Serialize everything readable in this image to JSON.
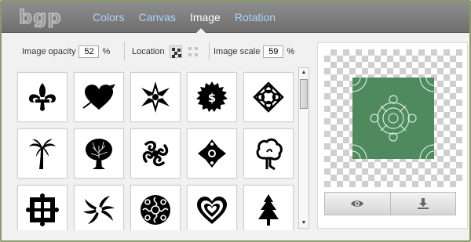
{
  "app": {
    "logo_text": "bgp"
  },
  "nav": {
    "tabs": [
      {
        "label": "Colors",
        "active": false
      },
      {
        "label": "Canvas",
        "active": false
      },
      {
        "label": "Image",
        "active": true
      },
      {
        "label": "Rotation",
        "active": false
      }
    ]
  },
  "controls": {
    "opacity_label": "Image opacity",
    "opacity_value": "52",
    "opacity_unit": "%",
    "location_label": "Location",
    "scale_label": "Image scale",
    "scale_value": "59",
    "scale_unit": "%"
  },
  "icons": [
    [
      "fleur-de-lis-icon",
      "heart-arrow-icon",
      "star-burst-icon",
      "dollar-seal-icon",
      "celtic-knot-icon"
    ],
    [
      "palm-tree-icon",
      "oak-tree-icon",
      "swirl-flourish-icon",
      "diamond-ornament-icon",
      "cartoon-tree-icon"
    ],
    [
      "square-ornament-icon",
      "spiral-sun-icon",
      "round-filigree-icon",
      "nested-hearts-icon",
      "pine-tree-icon"
    ]
  ],
  "preview": {
    "view_button": "eye-icon",
    "download_button": "download-icon",
    "pattern_color": "#4e8a5e"
  },
  "colors": {
    "tab_inactive": "#a9d4f5",
    "tab_active": "#ffffff",
    "frame_border": "#8a9a6a"
  }
}
